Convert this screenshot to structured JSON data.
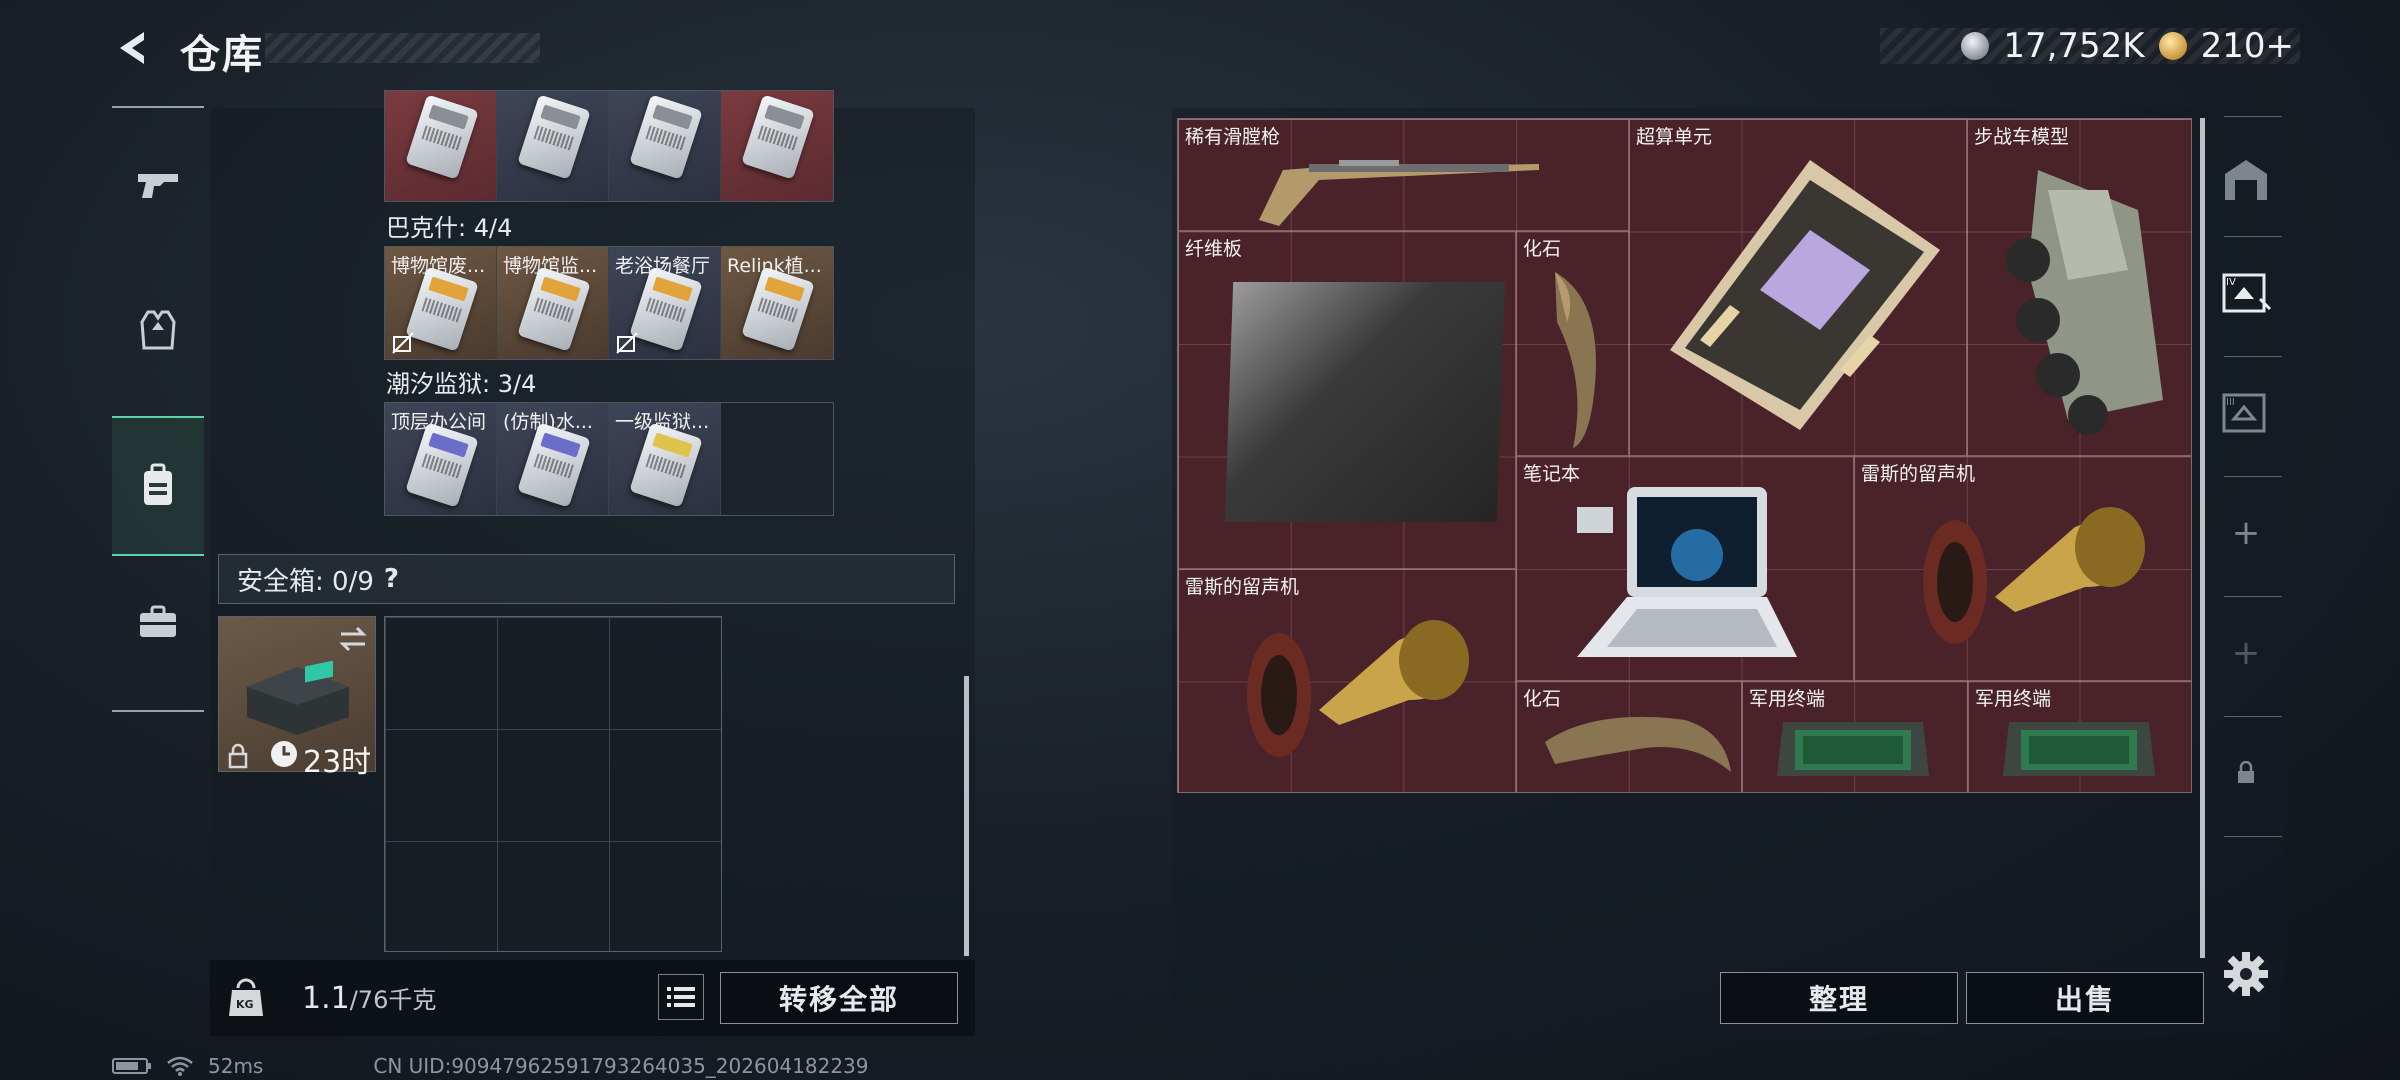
{
  "header": {
    "title": "仓库"
  },
  "currency": {
    "silver": "17,752K",
    "gold": "210+"
  },
  "left": {
    "top_row": [
      {
        "style": "red"
      },
      {
        "style": "blue"
      },
      {
        "style": "blue"
      },
      {
        "style": "red"
      }
    ],
    "groups": [
      {
        "label": "巴克什: 4/4",
        "cards": [
          {
            "name": "博物馆废...",
            "style": "gold",
            "unbind": true
          },
          {
            "name": "博物馆监...",
            "style": "gold",
            "unbind": false
          },
          {
            "name": "老浴场餐厅",
            "style": "gold",
            "unbind": true
          },
          {
            "name": "Relink植...",
            "style": "gold",
            "unbind": false
          }
        ]
      },
      {
        "label": "潮汐监狱: 3/4",
        "cards": [
          {
            "name": "顶层办公间",
            "style": "blue",
            "unbind": false
          },
          {
            "name": "(仿制)水...",
            "style": "blue",
            "unbind": false
          },
          {
            "name": "一级监狱...",
            "style": "blue",
            "unbind": false
          },
          {
            "name": "",
            "style": "empty",
            "unbind": false
          }
        ]
      }
    ],
    "safebox": {
      "label": "安全箱: 0/9",
      "help": "?",
      "timer": "23时"
    },
    "weight": {
      "current": "1.1",
      "max": "/76千克",
      "unit_badge": "KG"
    },
    "transfer_all": "转移全部"
  },
  "status": {
    "ping": "52ms",
    "uid": "CN UID:9094796259179326403​5_202604182239"
  },
  "stash": {
    "items": [
      {
        "name": "稀有滑膛枪",
        "art": "rifle"
      },
      {
        "name": "超算单元",
        "art": "cpu"
      },
      {
        "name": "步战车模型",
        "art": "vehicle"
      },
      {
        "name": "纤维板",
        "art": "board"
      },
      {
        "name": "化石",
        "art": "fossil"
      },
      {
        "name": "笔记本",
        "art": "laptop"
      },
      {
        "name": "雷斯的留声机",
        "art": "gramophone"
      },
      {
        "name": "雷斯的留声机",
        "art": "gramophone"
      },
      {
        "name": "化石",
        "art": "fossil"
      },
      {
        "name": "军用终端",
        "art": "terminal"
      },
      {
        "name": "军用终端",
        "art": "terminal"
      }
    ],
    "sort": "整理",
    "sell": "出售"
  },
  "right_nav": {
    "plus1": "+",
    "plus2": "+"
  },
  "colors": {
    "accent_green": "#5fd3a8",
    "stash_red": "#4a2229"
  }
}
